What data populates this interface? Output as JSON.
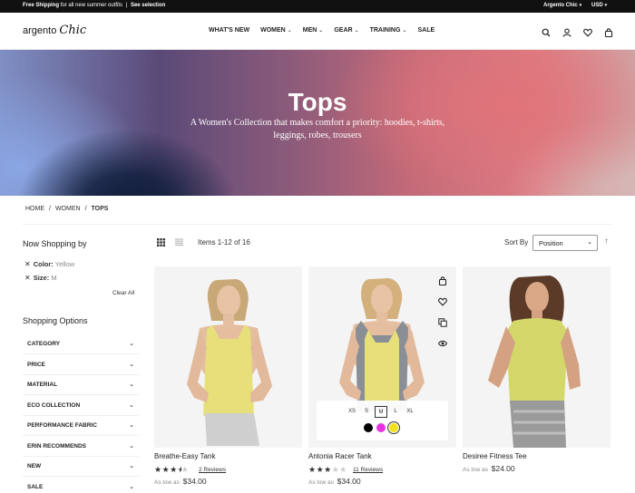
{
  "topbar": {
    "promo_bold": "Free Shipping",
    "promo_text": "for all new summer outfits",
    "promo_sep": "|",
    "promo_link": "See selection",
    "store": "Argento Chic",
    "currency": "USD"
  },
  "header": {
    "logo_a": "argento",
    "logo_b": "Chic",
    "nav": [
      "WHAT'S NEW",
      "WOMEN",
      "MEN",
      "GEAR",
      "TRAINING",
      "SALE"
    ],
    "icons": [
      "search-icon",
      "account-icon",
      "heart-icon",
      "bag-icon"
    ]
  },
  "hero": {
    "title": "Tops",
    "subtitle": "A Women's Collection that makes comfort a priority: hoodies, t-shirts, leggings, robes, trousers"
  },
  "breadcrumb": [
    "HOME",
    "WOMEN",
    "TOPS"
  ],
  "sidebar": {
    "now_shopping": "Now Shopping by",
    "filters": [
      {
        "label": "Color:",
        "value": "Yellow"
      },
      {
        "label": "Size:",
        "value": "M"
      }
    ],
    "clear_all": "Clear All",
    "options_title": "Shopping Options",
    "options": [
      "CATEGORY",
      "PRICE",
      "MATERIAL",
      "ECO COLLECTION",
      "PERFORMANCE FABRIC",
      "ERIN RECOMMENDS",
      "NEW",
      "SALE"
    ]
  },
  "toolbar": {
    "items": "Items 1-12 of 16",
    "sort_label": "Sort By",
    "sort_value": "Position"
  },
  "products": [
    {
      "name": "Breathe-Easy Tank",
      "rating": 3.5,
      "reviews": "2  Reviews",
      "as_low": "As low as",
      "price": "$34.00"
    },
    {
      "name": "Antonia Racer Tank",
      "rating": 3,
      "reviews": "11  Reviews",
      "as_low": "As low as",
      "price": "$34.00",
      "sizes": [
        "XS",
        "S",
        "M",
        "L",
        "XL"
      ],
      "selected_size": "M",
      "swatches": [
        "#000000",
        "#e635e0",
        "#f2e11d"
      ],
      "selected_swatch": 2
    },
    {
      "name": "Desiree Fitness Tee",
      "as_low": "As low as",
      "price": "$24.00"
    }
  ]
}
